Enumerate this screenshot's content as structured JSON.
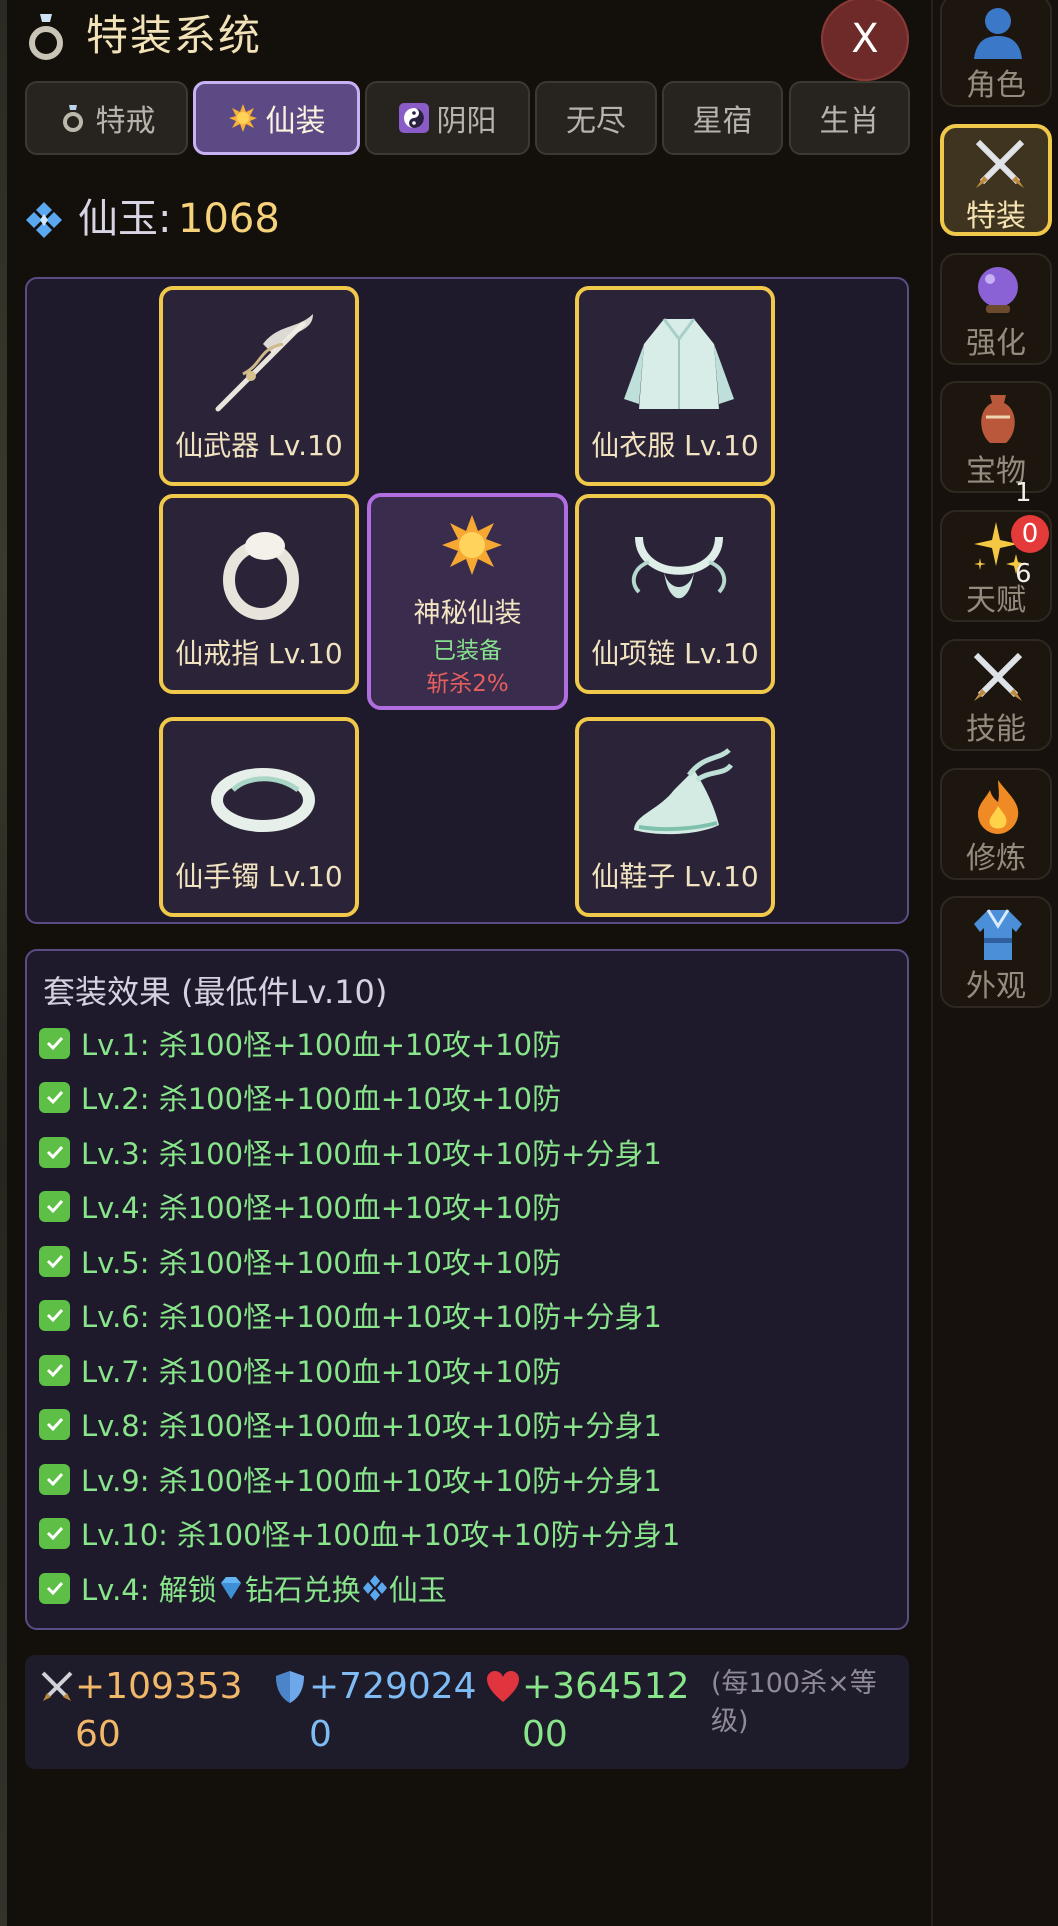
{
  "header": {
    "title": "特装系统",
    "close_label": "X"
  },
  "tabs": [
    {
      "label": "特戒",
      "icon": "ring-icon"
    },
    {
      "label": "仙装",
      "icon": "sun-icon",
      "active": true
    },
    {
      "label": "阴阳",
      "icon": "yin-yang-icon"
    },
    {
      "label": "无尽"
    },
    {
      "label": "星宿"
    },
    {
      "label": "生肖"
    }
  ],
  "currency": {
    "label": "仙玉:",
    "value": "1068",
    "icon": "jade-gem-icon"
  },
  "equipment": {
    "weapon": "仙武器 Lv.10",
    "robe": "仙衣服 Lv.10",
    "ring": "仙戒指 Lv.10",
    "necklace": "仙项链 Lv.10",
    "bracelet": "仙手镯 Lv.10",
    "shoes": "仙鞋子 Lv.10",
    "center": {
      "name": "神秘仙装",
      "status": "已装备",
      "bonus": "斩杀2%"
    }
  },
  "set_effects": {
    "title": "套装效果 (最低件Lv.10)",
    "lines": [
      "Lv.1: 杀100怪+100血+10攻+10防",
      "Lv.2: 杀100怪+100血+10攻+10防",
      "Lv.3: 杀100怪+100血+10攻+10防+分身1",
      "Lv.4: 杀100怪+100血+10攻+10防",
      "Lv.5: 杀100怪+100血+10攻+10防",
      "Lv.6: 杀100怪+100血+10攻+10防+分身1",
      "Lv.7: 杀100怪+100血+10攻+10防",
      "Lv.8: 杀100怪+100血+10攻+10防+分身1",
      "Lv.9: 杀100怪+100血+10攻+10防+分身1",
      "Lv.10: 杀100怪+100血+10攻+10防+分身1"
    ],
    "unlock": {
      "prefix": "Lv.4: 解锁",
      "mid": "钻石兑换",
      "suffix": "仙玉"
    }
  },
  "stats": {
    "attack": "+10935360",
    "defense": "+7290240",
    "hp": "+36451200",
    "note": "(每100杀×等级)"
  },
  "sidebar": [
    {
      "label": "角色",
      "icon": "person-icon"
    },
    {
      "label": "特装",
      "icon": "crossed-swords-icon",
      "active": true
    },
    {
      "label": "强化",
      "icon": "crystal-ball-icon"
    },
    {
      "label": "宝物",
      "icon": "vase-icon"
    },
    {
      "label": "天赋",
      "icon": "sparkles-icon",
      "count_top": "1",
      "badge": "0",
      "count_bottom": "6"
    },
    {
      "label": "技能",
      "icon": "crossed-swords-icon"
    },
    {
      "label": "修炼",
      "icon": "fire-icon"
    },
    {
      "label": "外观",
      "icon": "robe-icon"
    }
  ],
  "colors": {
    "gold": "#f0c84a",
    "purple": "#b06ee0",
    "green": "#88e58a",
    "accent_tab": "#5b4a83"
  }
}
